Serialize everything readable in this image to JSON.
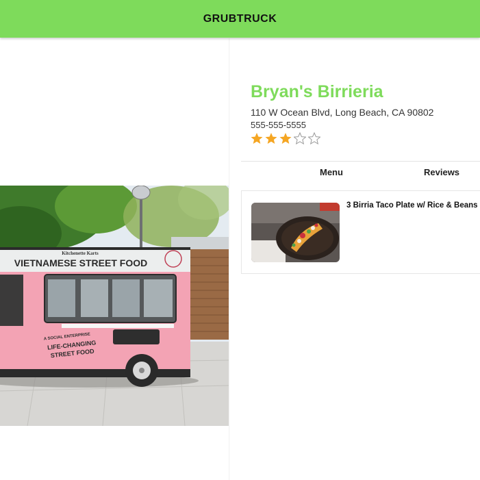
{
  "header": {
    "brand": "GRUBTRUCK"
  },
  "hero": {
    "truck_sign_small": "Kitchenette Karts",
    "truck_sign_main": "VIETNAMESE STREET FOOD",
    "truck_side_line1": "A SOCIAL ENTERPRISE",
    "truck_side_line2": "LIFE-CHANGING",
    "truck_side_line3": "STREET FOOD"
  },
  "truck": {
    "name": "Bryan's Birrieria",
    "address": "110 W Ocean Blvd, Long Beach, CA 90802",
    "phone": "555-555-5555",
    "rating": 3,
    "rating_max": 5,
    "star_color": "#f5a623"
  },
  "tabs": [
    {
      "label": "Menu"
    },
    {
      "label": "Reviews"
    }
  ],
  "menu_items": [
    {
      "name": "3 Birria Taco Plate w/ Rice & Beans"
    }
  ],
  "colors": {
    "accent": "#7edb5b"
  }
}
